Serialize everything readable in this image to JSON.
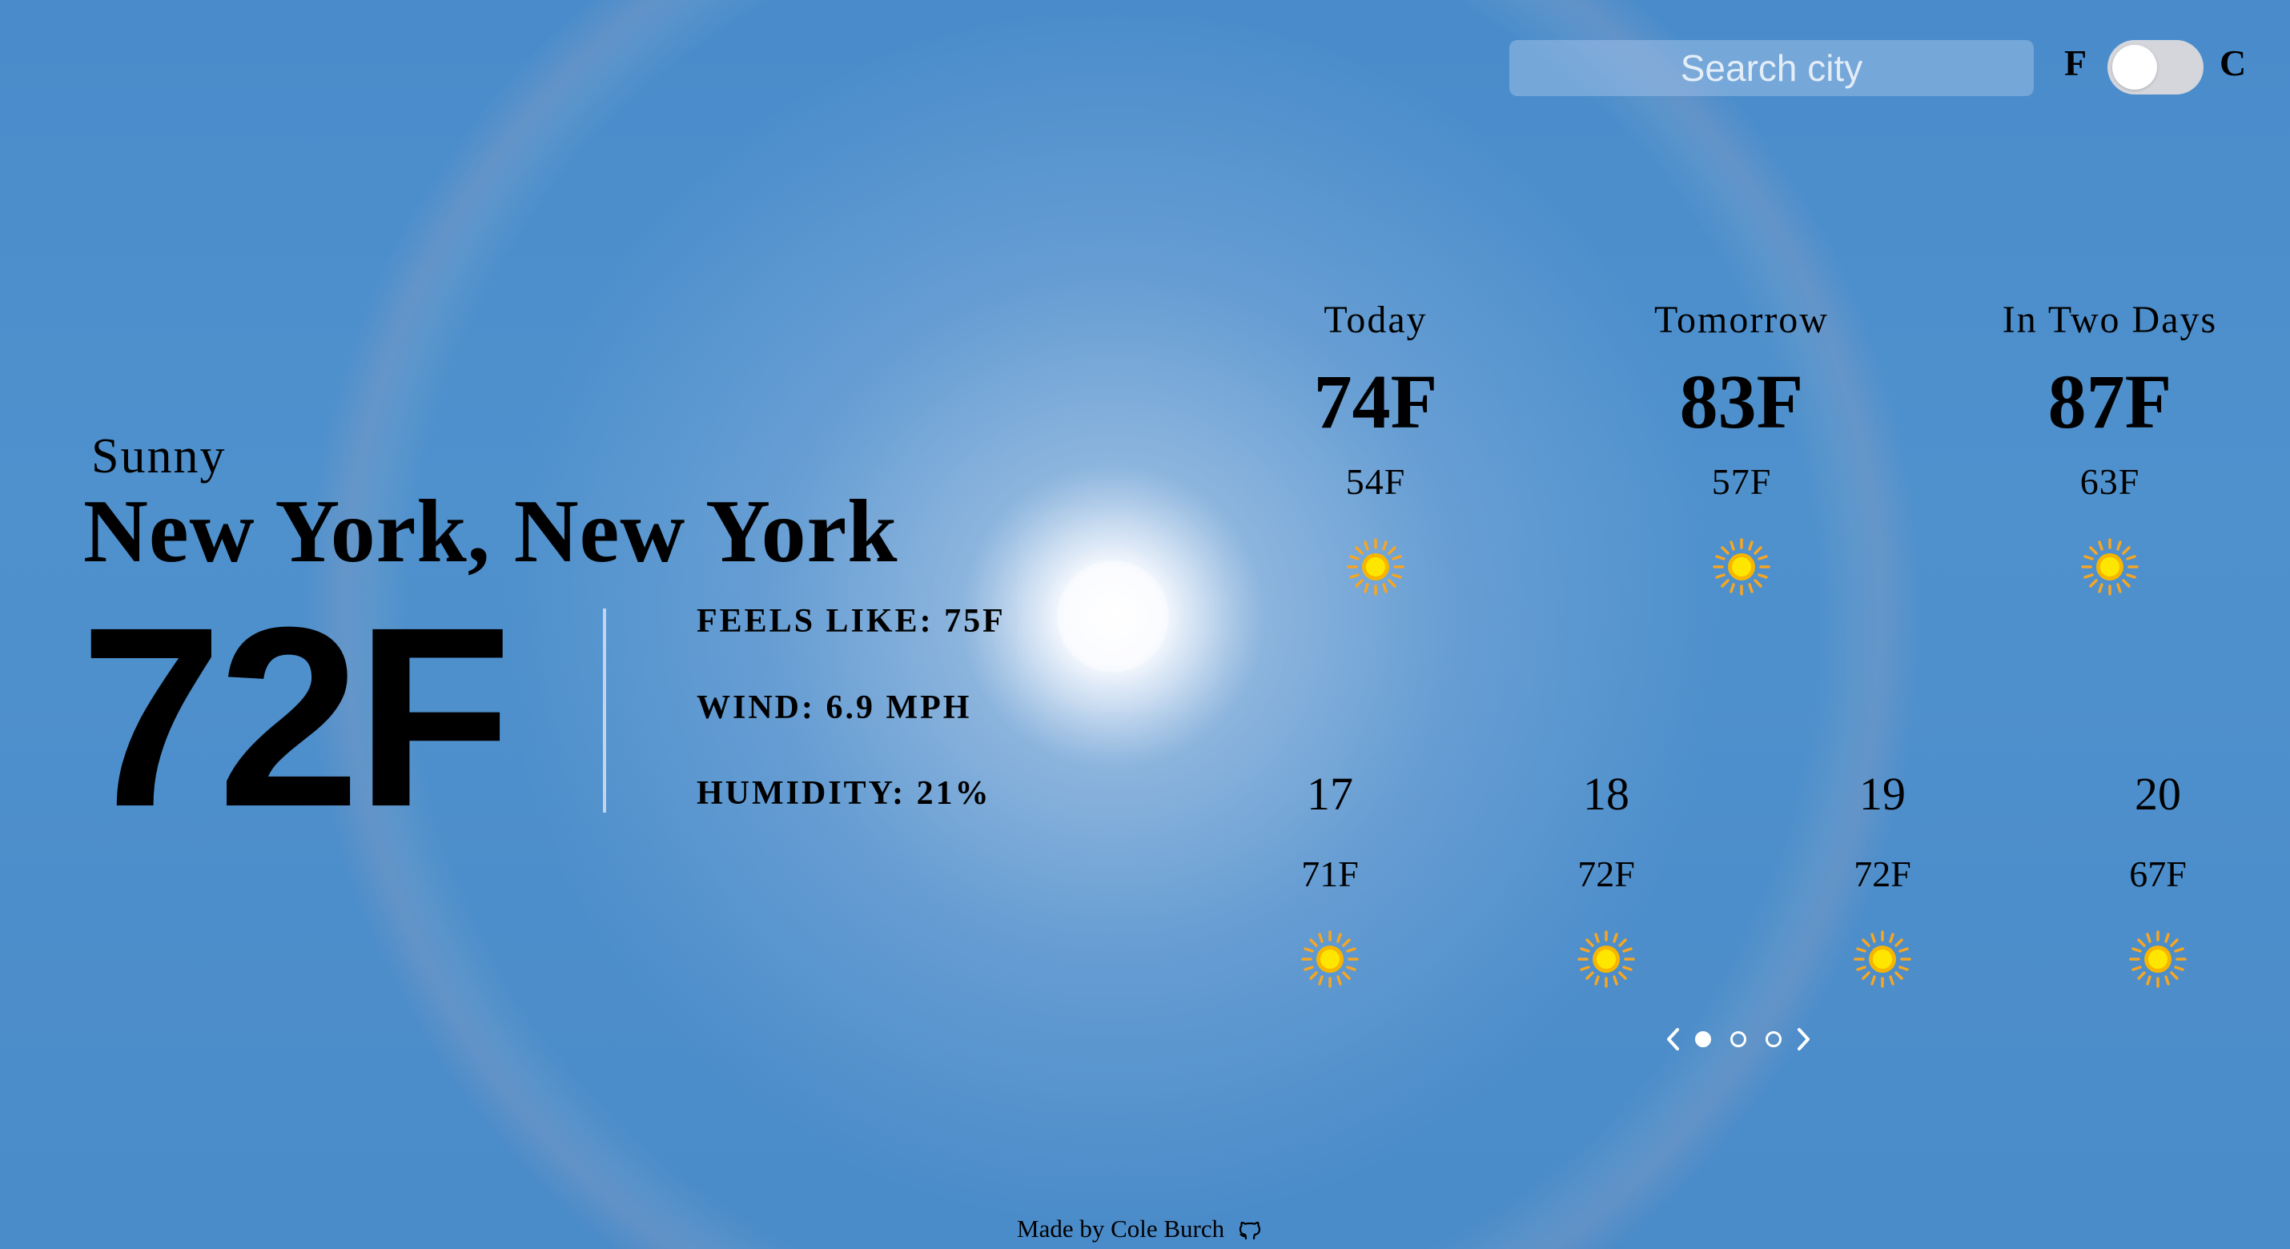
{
  "search": {
    "placeholder": "Search city",
    "value": ""
  },
  "units": {
    "fahrenheit_label": "F",
    "celsius_label": "C",
    "selected": "F"
  },
  "current": {
    "condition": "Sunny",
    "city": "New York, New York",
    "temperature": "72F",
    "feels_like": "FEELS LIKE: 75F",
    "wind": "WIND: 6.9 MPH",
    "humidity": "HUMIDITY: 21%"
  },
  "daily": [
    {
      "label": "Today",
      "high": "74F",
      "low": "54F",
      "icon": "sun-icon"
    },
    {
      "label": "Tomorrow",
      "high": "83F",
      "low": "57F",
      "icon": "sun-icon"
    },
    {
      "label": "In Two Days",
      "high": "87F",
      "low": "63F",
      "icon": "sun-icon"
    }
  ],
  "hourly": [
    {
      "label": "17",
      "temp": "71F",
      "icon": "sun-icon"
    },
    {
      "label": "18",
      "temp": "72F",
      "icon": "sun-icon"
    },
    {
      "label": "19",
      "temp": "72F",
      "icon": "sun-icon"
    },
    {
      "label": "20",
      "temp": "67F",
      "icon": "sun-icon"
    }
  ],
  "pagination": {
    "pages": 3,
    "active_page": 1,
    "prev_icon": "chevron-left-icon",
    "next_icon": "chevron-right-icon"
  },
  "footer": {
    "text": "Made by Cole Burch",
    "icon": "github-icon"
  },
  "colors": {
    "sky": "#4a8ccb",
    "sun_icon_core": "#ffe600",
    "sun_icon_rays": "#f5a623",
    "text": "#000000"
  }
}
